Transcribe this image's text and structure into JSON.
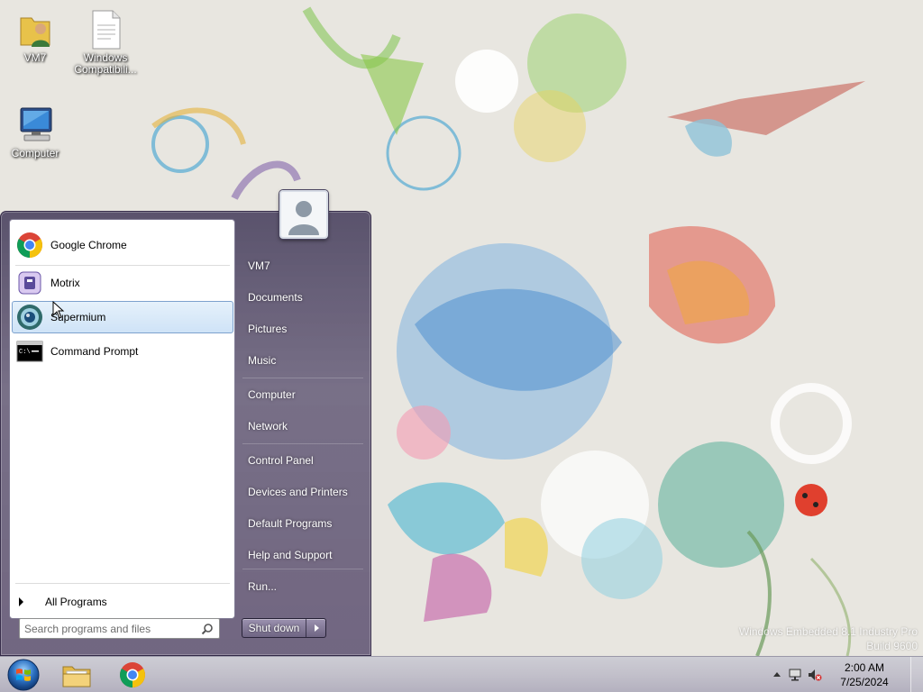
{
  "desktop": {
    "icons": [
      {
        "label": "VM7",
        "icon": "user-folder-icon"
      },
      {
        "label": "Windows Compatibili...",
        "icon": "document-icon"
      },
      {
        "label": "Computer",
        "icon": "computer-icon"
      }
    ],
    "watermark": {
      "line1": "Windows Embedded 8.1 Industry Pro",
      "line2": "Build 9600"
    }
  },
  "start_menu": {
    "programs": [
      {
        "label": "Google Chrome",
        "icon": "chrome-icon"
      },
      {
        "label": "Motrix",
        "icon": "motrix-icon"
      },
      {
        "label": "Supermium",
        "icon": "supermium-icon",
        "hovered": true
      },
      {
        "label": "Command Prompt",
        "icon": "cmd-icon"
      }
    ],
    "all_programs_label": "All Programs",
    "search_placeholder": "Search programs and files",
    "user_picture": "user-avatar-icon",
    "right_links": [
      {
        "label": "VM7"
      },
      {
        "label": "Documents"
      },
      {
        "label": "Pictures"
      },
      {
        "label": "Music"
      },
      {
        "label": "Computer"
      },
      {
        "label": "Network"
      },
      {
        "label": "Control Panel"
      },
      {
        "label": "Devices and Printers"
      },
      {
        "label": "Default Programs"
      },
      {
        "label": "Help and Support"
      },
      {
        "label": "Run..."
      }
    ],
    "shutdown_label": "Shut down"
  },
  "taskbar": {
    "pinned": [
      {
        "name": "File Explorer",
        "icon": "folder-icon"
      },
      {
        "name": "Google Chrome",
        "icon": "chrome-icon"
      }
    ],
    "tray": {
      "icons": [
        "show-hidden-icons-arrow",
        "network-icon",
        "volume-muted-icon"
      ],
      "time": "2:00 AM",
      "date": "7/25/2024"
    }
  },
  "colors": {
    "start_menu_glass": "#5e5475",
    "hover_highlight": "#cfe3f7",
    "taskbar": "#c4c2cf"
  }
}
